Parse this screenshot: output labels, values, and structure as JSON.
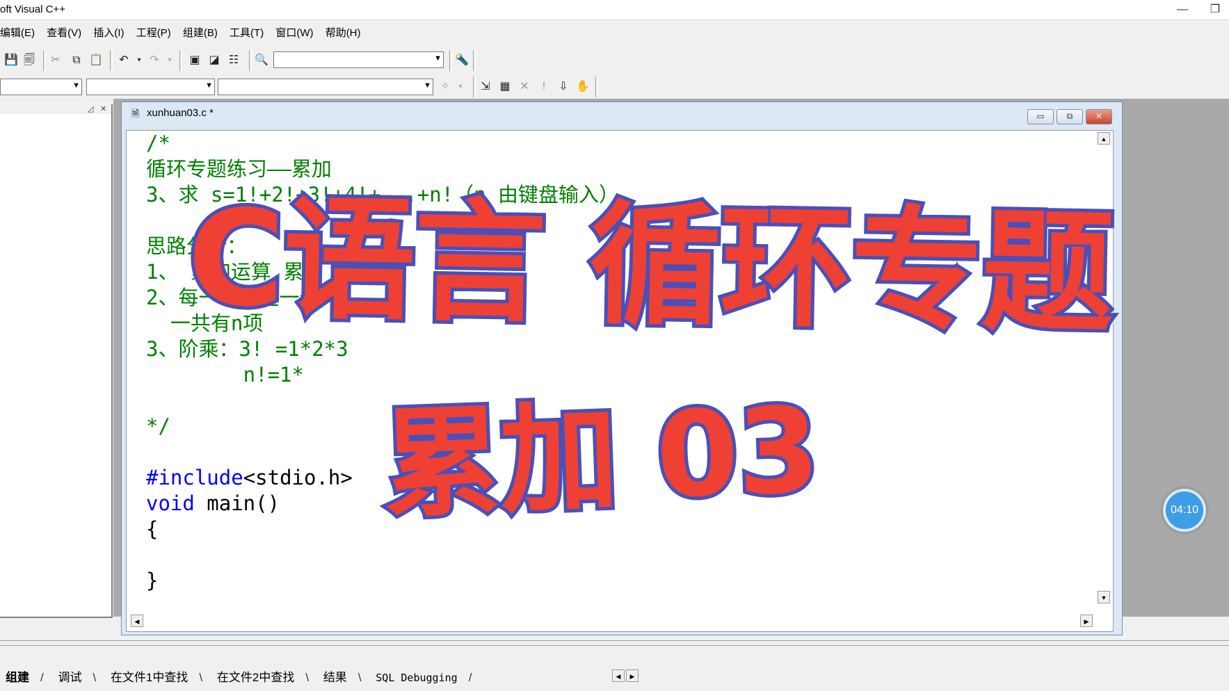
{
  "app": {
    "title": "oft Visual C++",
    "minimize": "—",
    "restore": "❐"
  },
  "menu": [
    "编辑(E)",
    "查看(V)",
    "插入(I)",
    "工程(P)",
    "组建(B)",
    "工具(T)",
    "窗口(W)",
    "帮助(H)"
  ],
  "editor": {
    "window_title": "xunhuan03.c *",
    "code_lines": [
      {
        "cls": "cmt",
        "text": "/*"
      },
      {
        "cls": "cmt",
        "text": "循环专题练习——累加"
      },
      {
        "cls": "cmt",
        "text": "3、求 s=1!+2!+3!+4!+...+n!（n 由键盘输入）"
      },
      {
        "cls": "cmt",
        "text": ""
      },
      {
        "cls": "cmt",
        "text": "思路分析："
      },
      {
        "cls": "cmt",
        "text": "1、 累加运算 累"
      },
      {
        "cls": "cmt",
        "text": "2、每一项都是一个"
      },
      {
        "cls": "cmt",
        "text": "  一共有n项"
      },
      {
        "cls": "cmt",
        "text": "3、阶乘：3! =1*2*3"
      },
      {
        "cls": "cmt",
        "text": "        n!=1*"
      },
      {
        "cls": "cmt",
        "text": ""
      },
      {
        "cls": "cmt",
        "text": "*/"
      },
      {
        "cls": "cmt",
        "text": ""
      },
      {
        "cls": "kw",
        "text": "#include",
        "rest": "<stdio.h>"
      },
      {
        "cls": "kw",
        "text": "void",
        "rest": " main()"
      },
      {
        "cls": "txt",
        "text": "{"
      },
      {
        "cls": "txt",
        "text": ""
      },
      {
        "cls": "txt",
        "text": "}"
      }
    ]
  },
  "overlay": {
    "title": "C语言 循环专题",
    "subtitle": "累加 03"
  },
  "timer": "04:10",
  "output_tabs": [
    "组建",
    "调试",
    "在文件1中查找",
    "在文件2中查找",
    "结果",
    "SQL Debugging"
  ],
  "icons": {
    "save": "save-icon",
    "save_all": "save-all-icon",
    "cut": "cut-icon",
    "copy": "copy-icon",
    "paste": "paste-icon",
    "undo": "undo-icon",
    "redo": "redo-icon"
  }
}
